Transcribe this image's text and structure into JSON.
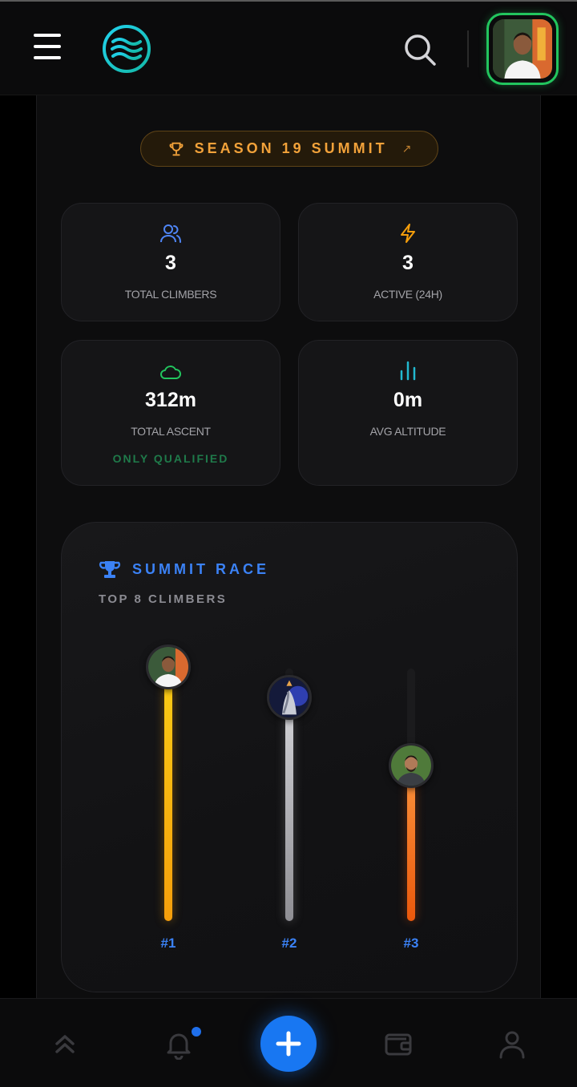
{
  "header": {
    "menu_icon": "hamburger-menu-icon",
    "logo_icon": "waves-logo-icon",
    "search_icon": "search-icon",
    "avatar": "user-avatar"
  },
  "season": {
    "label": "SEASON 19 SUMMIT",
    "arrow": "↗",
    "icon": "trophy-icon"
  },
  "stats": [
    {
      "icon": "users-icon",
      "value": "3",
      "label": "TOTAL CLIMBERS",
      "color": "#4f86f7"
    },
    {
      "icon": "lightning-icon",
      "value": "3",
      "label": "ACTIVE (24H)",
      "color": "#f59e0b"
    },
    {
      "icon": "cloud-icon",
      "value": "312m",
      "label": "TOTAL ASCENT",
      "note": "ONLY QUALIFIED",
      "color": "#22c55e"
    },
    {
      "icon": "bar-chart-icon",
      "value": "0m",
      "label": "AVG ALTITUDE",
      "color": "#22b8cf"
    }
  ],
  "race": {
    "title": "SUMMIT RACE",
    "subtitle": "TOP 8 CLIMBERS",
    "climbers": [
      {
        "rank": "#1",
        "level": 1.0,
        "color_top": "#facc15",
        "color_bottom": "#f59e0b"
      },
      {
        "rank": "#2",
        "level": 0.88,
        "color_top": "#d4d4d8",
        "color_bottom": "#8e8e94"
      },
      {
        "rank": "#3",
        "level": 0.61,
        "color_top": "#fb923c",
        "color_bottom": "#ea580c"
      }
    ]
  },
  "nav": {
    "items": [
      "chevrons-up-icon",
      "bell-icon",
      "plus-icon",
      "wallet-icon",
      "user-icon"
    ]
  },
  "colors": {
    "accent_blue": "#3b82f6",
    "accent_green": "#22c55e",
    "accent_gold": "#f2a23a"
  }
}
